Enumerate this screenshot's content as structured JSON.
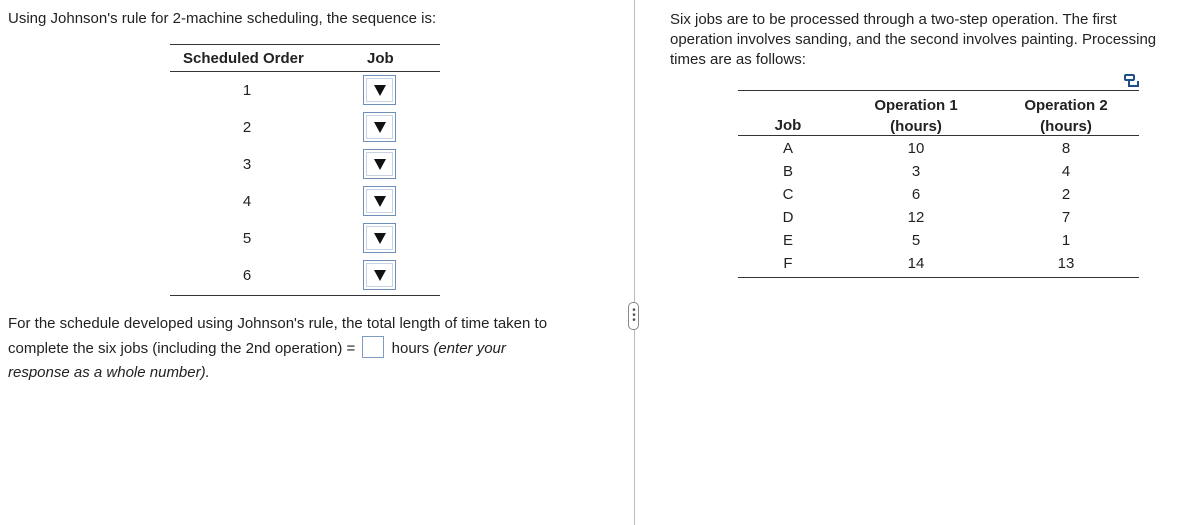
{
  "left": {
    "intro": "Using Johnson's rule for 2-machine scheduling, the sequence is:",
    "schedule": {
      "headers": {
        "order": "Scheduled Order",
        "job": "Job"
      },
      "rows": [
        {
          "order": "1",
          "selected": ""
        },
        {
          "order": "2",
          "selected": ""
        },
        {
          "order": "3",
          "selected": ""
        },
        {
          "order": "4",
          "selected": ""
        },
        {
          "order": "5",
          "selected": ""
        },
        {
          "order": "6",
          "selected": ""
        }
      ]
    },
    "result": {
      "line1": "For the schedule developed using Johnson's rule, the total length of time taken to",
      "line2_before": "complete the six jobs (including the 2nd operation) =",
      "answer_value": "",
      "line2_after": "hours",
      "hint1": "(enter your",
      "hint2": "response as a whole number)."
    }
  },
  "right": {
    "problem_lines": [
      "Six jobs are to be processed through a two-step operation.  The first",
      "operation involves sanding, and the second involves painting. Processing",
      "times are as follows:"
    ],
    "table": {
      "headers": {
        "job": "Job",
        "op1_line1": "Operation 1",
        "op1_line2": "(hours)",
        "op2_line1": "Operation 2",
        "op2_line2": "(hours)"
      },
      "rows": [
        {
          "job": "A",
          "op1": "10",
          "op2": "8"
        },
        {
          "job": "B",
          "op1": "3",
          "op2": "4"
        },
        {
          "job": "C",
          "op1": "6",
          "op2": "2"
        },
        {
          "job": "D",
          "op1": "12",
          "op2": "7"
        },
        {
          "job": "E",
          "op1": "5",
          "op2": "1"
        },
        {
          "job": "F",
          "op1": "14",
          "op2": "13"
        }
      ]
    }
  },
  "icons": {
    "dropdown": "triangle-down-icon",
    "splitter": "vertical-dots-icon",
    "copy": "copy-data-icon"
  },
  "colors": {
    "input_border": "#7e9bc1",
    "icon_blue": "#1f4f8a"
  }
}
